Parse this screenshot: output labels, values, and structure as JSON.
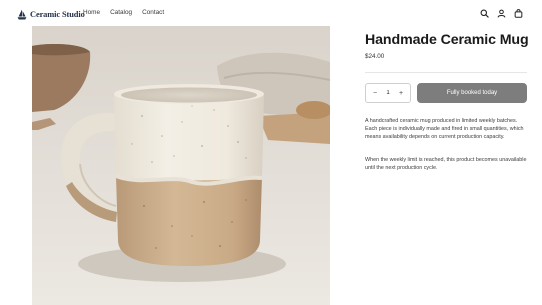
{
  "brand": {
    "name": "Ceramic Studio",
    "logo_icon": "ship-icon",
    "color": "#24324a"
  },
  "nav": {
    "items": [
      {
        "label": "Home"
      },
      {
        "label": "Catalog"
      },
      {
        "label": "Contact"
      }
    ]
  },
  "header_icons": [
    "search-icon",
    "user-icon",
    "cart-icon"
  ],
  "product": {
    "title": "Handmade Ceramic Mug",
    "price": "$24.00",
    "quantity": "1",
    "decrement_label": "−",
    "increment_label": "+",
    "cta_label": "Fully booked today",
    "cta_color": "#7d7d7d",
    "description": [
      "A handcrafted ceramic mug produced in limited weekly batches. Each piece is individually made and fired in small quantities, which means availability depends on current production capacity.",
      "When the weekly limit is reached, this product becomes unavailable until the next production cycle."
    ]
  }
}
